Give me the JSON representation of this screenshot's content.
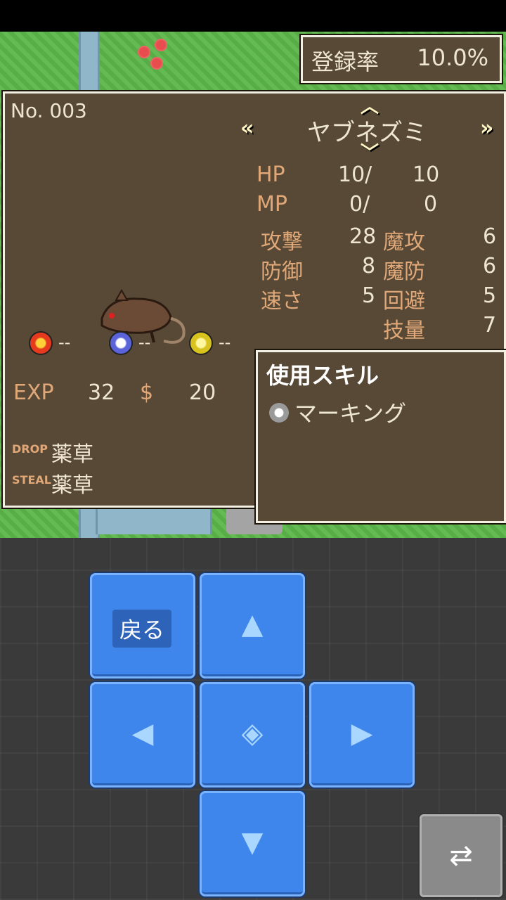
{
  "hud": {
    "rate_label": "登録率",
    "rate_value": "10.0%"
  },
  "monster": {
    "number": "No. 003",
    "name": "ヤブネズミ",
    "stats": {
      "hp_label": "HP",
      "hp_current": "10/",
      "hp_max": "10",
      "mp_label": "MP",
      "mp_current": "0/",
      "mp_max": "0",
      "atk_label": "攻撃",
      "atk": "28",
      "def_label": "防御",
      "def": "8",
      "spd_label": "速さ",
      "spd": "5",
      "matk_label": "魔攻",
      "matk": "6",
      "mdef_label": "魔防",
      "mdef": "6",
      "eva_label": "回避",
      "eva": "5",
      "tech_label": "技量",
      "tech": "7"
    },
    "resistances": [
      {
        "icon": "fire-icon",
        "value": "--",
        "color": "#e63a1f"
      },
      {
        "icon": "ice-icon",
        "value": "--",
        "color": "#5a63d8"
      },
      {
        "icon": "thunder-icon",
        "value": "--",
        "color": "#d8c21e"
      }
    ],
    "exp_label": "EXP",
    "exp": "32",
    "gold_label": "$",
    "gold": "20",
    "drop_label": "DROP",
    "drop": "薬草",
    "steal_label": "STEAL",
    "steal": "薬草"
  },
  "skills": {
    "title": "使用スキル",
    "items": [
      "マーキング"
    ]
  },
  "controls": {
    "back_label": "戻る",
    "up_icon": "up-arrow-icon",
    "down_icon": "down-arrow-icon",
    "left_icon": "left-arrow-icon",
    "right_icon": "right-arrow-icon",
    "center_icon": "confirm-icon",
    "swap_icon": "swap-icon"
  },
  "colors": {
    "panel": "#574935",
    "button": "#3f86ec",
    "grass": "#5cb64a"
  }
}
